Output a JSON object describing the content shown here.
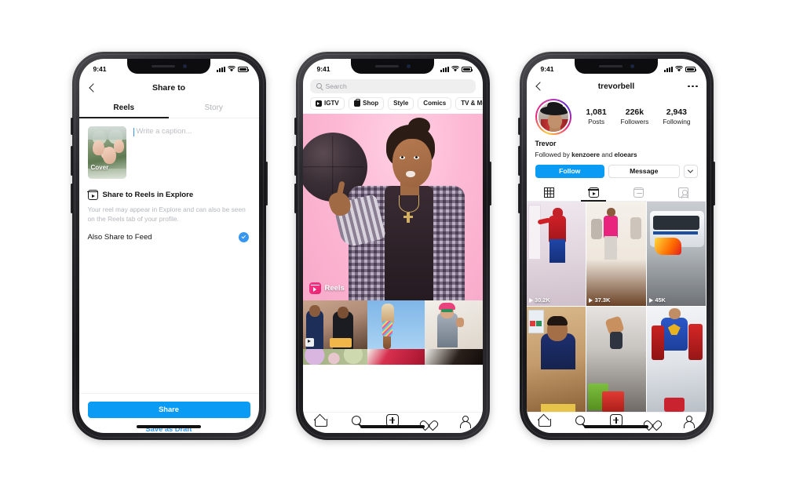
{
  "phone1": {
    "status": {
      "time": "9:41",
      "signal_icon": "signal-bars-icon",
      "wifi_icon": "wifi-icon",
      "battery_icon": "battery-icon"
    },
    "nav": {
      "back_icon": "chevron-left-icon",
      "title": "Share to"
    },
    "tabs": [
      {
        "label": "Reels",
        "active": true
      },
      {
        "label": "Story",
        "active": false
      }
    ],
    "cover": {
      "label": "Cover"
    },
    "caption": {
      "placeholder": "Write a caption..."
    },
    "explore": {
      "icon": "reels-icon",
      "title": "Share to Reels in Explore",
      "description": "Your reel may appear in Explore and can also be seen on the Reels tab of your profile."
    },
    "feed": {
      "label": "Also Share to Feed",
      "checked": true,
      "check_icon": "check-circle-icon"
    },
    "footer": {
      "share_label": "Share",
      "draft_label": "Save as Draft",
      "share_color": "#0a9bf5",
      "draft_color": "#3797f0"
    }
  },
  "phone2": {
    "status": {
      "time": "9:41",
      "signal_icon": "signal-bars-icon",
      "wifi_icon": "wifi-icon",
      "battery_icon": "battery-icon"
    },
    "search": {
      "placeholder": "Search",
      "icon": "search-icon"
    },
    "pills": [
      {
        "label": "IGTV",
        "icon": "igtv-icon"
      },
      {
        "label": "Shop",
        "icon": "shop-bag-icon"
      },
      {
        "label": "Style",
        "icon": null
      },
      {
        "label": "Comics",
        "icon": null
      },
      {
        "label": "TV & Movies",
        "icon": null
      }
    ],
    "hero": {
      "badge_label": "Reels",
      "badge_icon": "reels-icon",
      "alt": "person spinning a basketball on pink background"
    },
    "grid_row1": [
      {
        "alt": "two people with a notebook",
        "badge": "reels-icon"
      },
      {
        "alt": "glittery hand against blue sky",
        "badge": null
      },
      {
        "alt": "person in colorful outfit and beanie",
        "badge": null
      }
    ],
    "grid_row2": [
      {
        "alt": "flowers"
      },
      {
        "alt": "red dress"
      },
      {
        "alt": "dark portrait"
      }
    ],
    "tabbar": [
      {
        "icon": "home-icon"
      },
      {
        "icon": "search-icon"
      },
      {
        "icon": "add-post-icon"
      },
      {
        "icon": "heart-icon"
      },
      {
        "icon": "profile-icon"
      }
    ]
  },
  "phone3": {
    "status": {
      "time": "9:41",
      "signal_icon": "signal-bars-icon",
      "wifi_icon": "wifi-icon",
      "battery_icon": "battery-icon"
    },
    "nav": {
      "back_icon": "chevron-left-icon",
      "title": "trevorbell",
      "more_icon": "more-options-icon"
    },
    "avatar": {
      "icon": "avatar",
      "alt": "man in black cowboy hat and red shirt"
    },
    "stats": [
      {
        "value": "1,081",
        "label": "Posts"
      },
      {
        "value": "226k",
        "label": "Followers"
      },
      {
        "value": "2,943",
        "label": "Following"
      }
    ],
    "name": "Trevor",
    "followed_by": {
      "prefix": "Followed by ",
      "user1": "kenzoere",
      "middle": " and ",
      "user2": "eloears"
    },
    "actions": {
      "follow_label": "Follow",
      "message_label": "Message",
      "dropdown_icon": "chevron-down-icon",
      "follow_color": "#0a9bf5"
    },
    "tabs": [
      {
        "icon": "grid-icon",
        "active": false
      },
      {
        "icon": "reels-icon",
        "active": true
      },
      {
        "icon": "igtv-icon",
        "active": false
      },
      {
        "icon": "tagged-icon",
        "active": false
      }
    ],
    "grid": [
      {
        "views": "30.2K",
        "alt": "person in spiderman costume in hallway"
      },
      {
        "views": "37.3K",
        "alt": "people dancing in living room"
      },
      {
        "views": "45K",
        "alt": "city bus with fire effect"
      },
      {
        "views": "",
        "alt": "young man talking to camera"
      },
      {
        "views": "",
        "alt": "person box jumping in gym"
      },
      {
        "views": "",
        "alt": "person in superman costume"
      }
    ],
    "tabbar": [
      {
        "icon": "home-icon"
      },
      {
        "icon": "search-icon"
      },
      {
        "icon": "add-post-icon"
      },
      {
        "icon": "heart-icon"
      },
      {
        "icon": "profile-icon"
      }
    ]
  }
}
